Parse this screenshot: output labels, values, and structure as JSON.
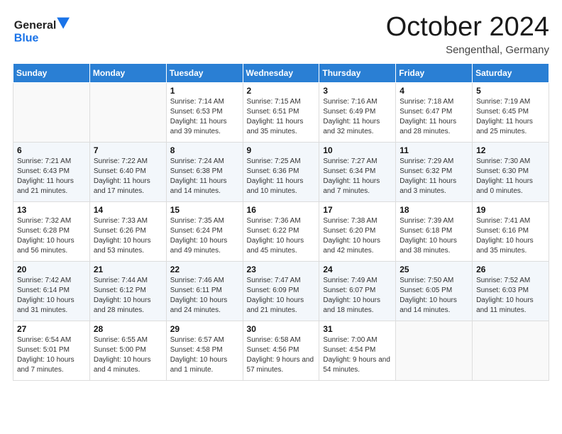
{
  "header": {
    "logo_line1": "General",
    "logo_line2": "Blue",
    "month": "October 2024",
    "location": "Sengenthal, Germany"
  },
  "days_of_week": [
    "Sunday",
    "Monday",
    "Tuesday",
    "Wednesday",
    "Thursday",
    "Friday",
    "Saturday"
  ],
  "weeks": [
    [
      {
        "day": "",
        "sunrise": "",
        "sunset": "",
        "daylight": ""
      },
      {
        "day": "",
        "sunrise": "",
        "sunset": "",
        "daylight": ""
      },
      {
        "day": "1",
        "sunrise": "Sunrise: 7:14 AM",
        "sunset": "Sunset: 6:53 PM",
        "daylight": "Daylight: 11 hours and 39 minutes."
      },
      {
        "day": "2",
        "sunrise": "Sunrise: 7:15 AM",
        "sunset": "Sunset: 6:51 PM",
        "daylight": "Daylight: 11 hours and 35 minutes."
      },
      {
        "day": "3",
        "sunrise": "Sunrise: 7:16 AM",
        "sunset": "Sunset: 6:49 PM",
        "daylight": "Daylight: 11 hours and 32 minutes."
      },
      {
        "day": "4",
        "sunrise": "Sunrise: 7:18 AM",
        "sunset": "Sunset: 6:47 PM",
        "daylight": "Daylight: 11 hours and 28 minutes."
      },
      {
        "day": "5",
        "sunrise": "Sunrise: 7:19 AM",
        "sunset": "Sunset: 6:45 PM",
        "daylight": "Daylight: 11 hours and 25 minutes."
      }
    ],
    [
      {
        "day": "6",
        "sunrise": "Sunrise: 7:21 AM",
        "sunset": "Sunset: 6:43 PM",
        "daylight": "Daylight: 11 hours and 21 minutes."
      },
      {
        "day": "7",
        "sunrise": "Sunrise: 7:22 AM",
        "sunset": "Sunset: 6:40 PM",
        "daylight": "Daylight: 11 hours and 17 minutes."
      },
      {
        "day": "8",
        "sunrise": "Sunrise: 7:24 AM",
        "sunset": "Sunset: 6:38 PM",
        "daylight": "Daylight: 11 hours and 14 minutes."
      },
      {
        "day": "9",
        "sunrise": "Sunrise: 7:25 AM",
        "sunset": "Sunset: 6:36 PM",
        "daylight": "Daylight: 11 hours and 10 minutes."
      },
      {
        "day": "10",
        "sunrise": "Sunrise: 7:27 AM",
        "sunset": "Sunset: 6:34 PM",
        "daylight": "Daylight: 11 hours and 7 minutes."
      },
      {
        "day": "11",
        "sunrise": "Sunrise: 7:29 AM",
        "sunset": "Sunset: 6:32 PM",
        "daylight": "Daylight: 11 hours and 3 minutes."
      },
      {
        "day": "12",
        "sunrise": "Sunrise: 7:30 AM",
        "sunset": "Sunset: 6:30 PM",
        "daylight": "Daylight: 11 hours and 0 minutes."
      }
    ],
    [
      {
        "day": "13",
        "sunrise": "Sunrise: 7:32 AM",
        "sunset": "Sunset: 6:28 PM",
        "daylight": "Daylight: 10 hours and 56 minutes."
      },
      {
        "day": "14",
        "sunrise": "Sunrise: 7:33 AM",
        "sunset": "Sunset: 6:26 PM",
        "daylight": "Daylight: 10 hours and 53 minutes."
      },
      {
        "day": "15",
        "sunrise": "Sunrise: 7:35 AM",
        "sunset": "Sunset: 6:24 PM",
        "daylight": "Daylight: 10 hours and 49 minutes."
      },
      {
        "day": "16",
        "sunrise": "Sunrise: 7:36 AM",
        "sunset": "Sunset: 6:22 PM",
        "daylight": "Daylight: 10 hours and 45 minutes."
      },
      {
        "day": "17",
        "sunrise": "Sunrise: 7:38 AM",
        "sunset": "Sunset: 6:20 PM",
        "daylight": "Daylight: 10 hours and 42 minutes."
      },
      {
        "day": "18",
        "sunrise": "Sunrise: 7:39 AM",
        "sunset": "Sunset: 6:18 PM",
        "daylight": "Daylight: 10 hours and 38 minutes."
      },
      {
        "day": "19",
        "sunrise": "Sunrise: 7:41 AM",
        "sunset": "Sunset: 6:16 PM",
        "daylight": "Daylight: 10 hours and 35 minutes."
      }
    ],
    [
      {
        "day": "20",
        "sunrise": "Sunrise: 7:42 AM",
        "sunset": "Sunset: 6:14 PM",
        "daylight": "Daylight: 10 hours and 31 minutes."
      },
      {
        "day": "21",
        "sunrise": "Sunrise: 7:44 AM",
        "sunset": "Sunset: 6:12 PM",
        "daylight": "Daylight: 10 hours and 28 minutes."
      },
      {
        "day": "22",
        "sunrise": "Sunrise: 7:46 AM",
        "sunset": "Sunset: 6:11 PM",
        "daylight": "Daylight: 10 hours and 24 minutes."
      },
      {
        "day": "23",
        "sunrise": "Sunrise: 7:47 AM",
        "sunset": "Sunset: 6:09 PM",
        "daylight": "Daylight: 10 hours and 21 minutes."
      },
      {
        "day": "24",
        "sunrise": "Sunrise: 7:49 AM",
        "sunset": "Sunset: 6:07 PM",
        "daylight": "Daylight: 10 hours and 18 minutes."
      },
      {
        "day": "25",
        "sunrise": "Sunrise: 7:50 AM",
        "sunset": "Sunset: 6:05 PM",
        "daylight": "Daylight: 10 hours and 14 minutes."
      },
      {
        "day": "26",
        "sunrise": "Sunrise: 7:52 AM",
        "sunset": "Sunset: 6:03 PM",
        "daylight": "Daylight: 10 hours and 11 minutes."
      }
    ],
    [
      {
        "day": "27",
        "sunrise": "Sunrise: 6:54 AM",
        "sunset": "Sunset: 5:01 PM",
        "daylight": "Daylight: 10 hours and 7 minutes."
      },
      {
        "day": "28",
        "sunrise": "Sunrise: 6:55 AM",
        "sunset": "Sunset: 5:00 PM",
        "daylight": "Daylight: 10 hours and 4 minutes."
      },
      {
        "day": "29",
        "sunrise": "Sunrise: 6:57 AM",
        "sunset": "Sunset: 4:58 PM",
        "daylight": "Daylight: 10 hours and 1 minute."
      },
      {
        "day": "30",
        "sunrise": "Sunrise: 6:58 AM",
        "sunset": "Sunset: 4:56 PM",
        "daylight": "Daylight: 9 hours and 57 minutes."
      },
      {
        "day": "31",
        "sunrise": "Sunrise: 7:00 AM",
        "sunset": "Sunset: 4:54 PM",
        "daylight": "Daylight: 9 hours and 54 minutes."
      },
      {
        "day": "",
        "sunrise": "",
        "sunset": "",
        "daylight": ""
      },
      {
        "day": "",
        "sunrise": "",
        "sunset": "",
        "daylight": ""
      }
    ]
  ]
}
